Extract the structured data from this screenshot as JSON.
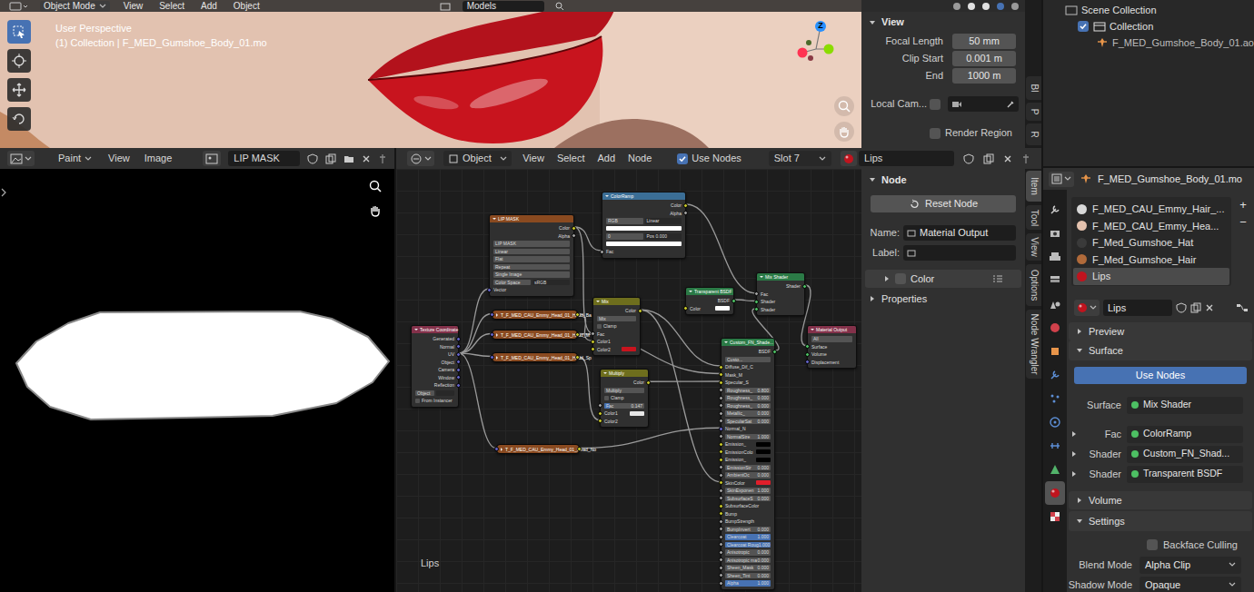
{
  "viewport": {
    "header": {
      "mode": "Object Mode",
      "menus": [
        "View",
        "Select",
        "Add",
        "Object"
      ],
      "collection": "Models"
    },
    "perspective": "User Perspective",
    "collection_line": "(1) Collection | F_MED_Gumshoe_Body_01.mo",
    "gizmo_axis": "Z",
    "tools": [
      {
        "selected": true
      },
      {
        "selected": false
      },
      {
        "selected": false
      },
      {
        "selected": false
      }
    ],
    "view_panel": {
      "title": "View",
      "expanded": true,
      "fields": [
        {
          "label": "Focal Length",
          "value": "50 mm"
        },
        {
          "label": "Clip Start",
          "value": "0.001 m"
        },
        {
          "label": "End",
          "value": "1000 m"
        }
      ],
      "local_camera": {
        "label": "Local Cam...",
        "checked": false
      },
      "render_region": {
        "label": "Render Region",
        "checked": false
      }
    },
    "tabs": [
      {
        "label": "Bl",
        "selected": false
      },
      {
        "label": "P",
        "selected": false
      },
      {
        "label": "R",
        "selected": false
      }
    ]
  },
  "outliner": {
    "items": [
      {
        "label": "Scene Collection",
        "kind": "scene"
      },
      {
        "label": "Collection",
        "kind": "collection",
        "checked": true
      },
      {
        "label": "F_MED_Gumshoe_Body_01.ao",
        "kind": "object"
      }
    ]
  },
  "image_editor": {
    "mode": "Paint",
    "menus": [
      "View",
      "Image"
    ],
    "image": "LIP MASK"
  },
  "node_editor": {
    "object": "Object",
    "menus": [
      "View",
      "Select",
      "Add",
      "Node"
    ],
    "use_nodes": {
      "label": "Use Nodes",
      "checked": true
    },
    "slot": "Slot 7",
    "material": "Lips",
    "label": "Lips",
    "nodes": [
      {
        "title": "Texture Coordinate",
        "kind": "full",
        "color": "#83314a",
        "rows": [
          {
            "kind": "out",
            "label": "Generated",
            "socket": "vector"
          },
          {
            "kind": "out",
            "label": "Normal",
            "socket": "vector"
          },
          {
            "kind": "out",
            "label": "UV",
            "socket": "vector"
          },
          {
            "kind": "out",
            "label": "Object",
            "socket": "vector"
          },
          {
            "kind": "out",
            "label": "Camera",
            "socket": "vector"
          },
          {
            "kind": "out",
            "label": "Window",
            "socket": "vector"
          },
          {
            "kind": "out",
            "label": "Reflection",
            "socket": "vector"
          },
          {
            "kind": "pair",
            "label": "Object",
            "value": ""
          },
          {
            "kind": "check",
            "label": "From Instancer",
            "checked": false
          }
        ]
      },
      {
        "title": "LIP MASK",
        "kind": "full",
        "color": "#8a4a20",
        "rows": [
          {
            "kind": "out",
            "label": "Color",
            "socket": "color"
          },
          {
            "kind": "out",
            "label": "Alpha",
            "socket": "float"
          },
          {
            "kind": "field",
            "label": "LIP MASK"
          },
          {
            "kind": "field",
            "label": "Linear"
          },
          {
            "kind": "field",
            "label": "Flat"
          },
          {
            "kind": "field",
            "label": "Repeat"
          },
          {
            "kind": "field",
            "label": "Single Image"
          },
          {
            "kind": "pair",
            "label": "Color Space",
            "value": "sRGB"
          },
          {
            "kind": "in",
            "label": "Vector",
            "socket": "vector"
          }
        ]
      },
      {
        "title": "ColorRamp",
        "kind": "full",
        "color": "#3b6e96",
        "rows": [
          {
            "kind": "out",
            "label": "Color",
            "socket": "color"
          },
          {
            "kind": "out",
            "label": "Alpha",
            "socket": "float"
          },
          {
            "kind": "pair",
            "label": "RGB",
            "value": "Linear"
          },
          {
            "kind": "bar",
            "color": "#ffffff"
          },
          {
            "kind": "pair",
            "label": "0",
            "value": "Pos 0.000"
          },
          {
            "kind": "bar",
            "color": "#ffffff"
          },
          {
            "kind": "in",
            "label": "Fac",
            "socket": "float"
          }
        ]
      },
      {
        "title": "Mix",
        "kind": "full",
        "color": "#6e6e1d",
        "rows": [
          {
            "kind": "out",
            "label": "Color",
            "socket": "color"
          },
          {
            "kind": "field",
            "label": "Mix"
          },
          {
            "kind": "check",
            "label": "Clamp",
            "checked": false
          },
          {
            "kind": "in",
            "label": "Fac",
            "socket": "float"
          },
          {
            "kind": "in",
            "label": "Color1",
            "socket": "color"
          },
          {
            "kind": "swatch",
            "label": "Color2",
            "color": "#c8141e",
            "socket": "color"
          }
        ]
      },
      {
        "title": "Multiply",
        "kind": "full",
        "color": "#6e6e1d",
        "rows": [
          {
            "kind": "out",
            "label": "Color",
            "socket": "color"
          },
          {
            "kind": "field",
            "label": "Multiply"
          },
          {
            "kind": "check",
            "label": "Clamp",
            "checked": false
          },
          {
            "kind": "slider",
            "label": "Fac",
            "value": "0.147",
            "level": 0.147,
            "socket": "float"
          },
          {
            "kind": "swatch",
            "label": "Color1",
            "color": "#e6e6e6",
            "socket": "color"
          },
          {
            "kind": "in",
            "label": "Color2",
            "socket": "color"
          }
        ]
      },
      {
        "title": "T_F_MED_CAU_Emmy_Head_01_Head_Ba",
        "kind": "collapsed",
        "color": "#8a4a20",
        "rows": []
      },
      {
        "title": "T_F_MED_CAU_Emmy_Head_01_Head_M",
        "kind": "collapsed",
        "color": "#8a4a20",
        "rows": []
      },
      {
        "title": "T_F_MED_CAU_Emmy_Head_01_Head_Sp",
        "kind": "collapsed",
        "color": "#8a4a20",
        "rows": []
      },
      {
        "title": "T_F_MED_CAU_Emmy_Head_01_Head_No",
        "kind": "collapsed",
        "color": "#8a4a20",
        "rows": []
      },
      {
        "title": "Transparent BSDF",
        "kind": "full",
        "color": "#2b7a46",
        "rows": [
          {
            "kind": "out",
            "label": "BSDF",
            "socket": "shader"
          },
          {
            "kind": "swatch",
            "label": "Color",
            "color": "#ffffff",
            "socket": "color"
          }
        ]
      },
      {
        "title": "Mix Shader",
        "kind": "full",
        "color": "#2b7a46",
        "rows": [
          {
            "kind": "out",
            "label": "Shader",
            "socket": "shader"
          },
          {
            "kind": "in",
            "label": "Fac",
            "socket": "float"
          },
          {
            "kind": "in",
            "label": "Shader",
            "socket": "shader"
          },
          {
            "kind": "in",
            "label": "Shader",
            "socket": "shader"
          }
        ]
      },
      {
        "title": "Material Output",
        "kind": "full",
        "color": "#83314a",
        "rows": [
          {
            "kind": "field",
            "label": "All"
          },
          {
            "kind": "in",
            "label": "Surface",
            "socket": "shader"
          },
          {
            "kind": "in",
            "label": "Volume",
            "socket": "shader"
          },
          {
            "kind": "in",
            "label": "Displacement",
            "socket": "vector"
          }
        ]
      },
      {
        "title": "Custom_FN_Shade...",
        "kind": "full",
        "color": "#2b7a46",
        "rows": [
          {
            "kind": "out",
            "label": "BSDF",
            "socket": "shader"
          },
          {
            "kind": "field",
            "label": "Custo..."
          },
          {
            "kind": "in",
            "label": "Diffuse_Dif_C",
            "socket": "color"
          },
          {
            "kind": "in",
            "label": "Mask_M",
            "socket": "color"
          },
          {
            "kind": "in",
            "label": "Specular_S",
            "socket": "color"
          },
          {
            "kind": "value",
            "label": "Roughness_",
            "value": "0.800",
            "socket": "float"
          },
          {
            "kind": "value",
            "label": "Roughness_",
            "value": "0.000",
            "socket": "float"
          },
          {
            "kind": "value",
            "label": "Roughness_",
            "value": "0.000",
            "socket": "float"
          },
          {
            "kind": "value",
            "label": "Metallic_",
            "value": "0.000",
            "socket": "float"
          },
          {
            "kind": "value",
            "label": "SpecularSat",
            "value": "0.000",
            "socket": "float"
          },
          {
            "kind": "in",
            "label": "Normal_N",
            "socket": "vector"
          },
          {
            "kind": "value",
            "label": "NormalStre",
            "value": "1.000",
            "socket": "float"
          },
          {
            "kind": "swatch",
            "label": "Emission_",
            "color": "#000000",
            "socket": "color"
          },
          {
            "kind": "swatch",
            "label": "EmissionColo",
            "color": "#000000",
            "socket": "color"
          },
          {
            "kind": "swatch",
            "label": "Emission_",
            "color": "#000000",
            "socket": "color"
          },
          {
            "kind": "value",
            "label": "EmissionStr",
            "value": "0.000",
            "socket": "float"
          },
          {
            "kind": "value",
            "label": "AmbientOc",
            "value": "0.000",
            "socket": "float"
          },
          {
            "kind": "swatch",
            "label": "SkinColor",
            "color": "#e01e2a",
            "socket": "color"
          },
          {
            "kind": "value",
            "label": "SkinExponen",
            "value": "1.000",
            "socket": "float"
          },
          {
            "kind": "value",
            "label": "SubsurfaceS",
            "value": "0.000",
            "socket": "float"
          },
          {
            "kind": "in",
            "label": "SubsurfaceColor",
            "socket": "color"
          },
          {
            "kind": "in",
            "label": "Bump",
            "socket": "color"
          },
          {
            "kind": "in",
            "label": "BumpStrength",
            "socket": "float"
          },
          {
            "kind": "value",
            "label": "BumpInvert",
            "value": "0.000",
            "socket": "float"
          },
          {
            "kind": "slider",
            "label": "Clearcoat",
            "value": "1.000",
            "level": 1,
            "socket": "float"
          },
          {
            "kind": "slider",
            "label": "Clearcoat Roug",
            "value": "1.000",
            "level": 1,
            "socket": "float"
          },
          {
            "kind": "value",
            "label": "Anisotropic",
            "value": "0.000",
            "socket": "float"
          },
          {
            "kind": "value",
            "label": "Anisotropic ma",
            "value": "0.000",
            "socket": "float"
          },
          {
            "kind": "value",
            "label": "Sheen_Mask",
            "value": "0.000",
            "socket": "float"
          },
          {
            "kind": "value",
            "label": "Sheen_Tint",
            "value": "0.000",
            "socket": "float"
          },
          {
            "kind": "slider",
            "label": "Alpha",
            "value": "1.000",
            "level": 1,
            "socket": "float"
          }
        ]
      }
    ]
  },
  "node_sidebar": {
    "panel": "Node",
    "expanded": true,
    "reset": "Reset Node",
    "name": {
      "label": "Name:",
      "value": "Material Output"
    },
    "label": {
      "label": "Label:",
      "value": ""
    },
    "color": {
      "label": "Color",
      "checked": false,
      "expanded": false
    },
    "properties": {
      "label": "Properties",
      "expanded": false
    },
    "tabs": [
      {
        "label": "Item",
        "selected": true
      },
      {
        "label": "Tool",
        "selected": false
      },
      {
        "label": "View",
        "selected": false
      },
      {
        "label": "Options",
        "selected": false
      },
      {
        "label": "Node Wrangler",
        "selected": false
      }
    ]
  },
  "properties": {
    "object": "F_MED_Gumshoe_Body_01.mo",
    "tabs": [
      {
        "selected": false
      },
      {
        "selected": false
      },
      {
        "selected": false
      },
      {
        "selected": false
      },
      {
        "selected": false
      },
      {
        "selected": false
      },
      {
        "selected": false
      },
      {
        "selected": false
      },
      {
        "selected": false
      },
      {
        "selected": false
      },
      {
        "selected": false
      },
      {
        "selected": false
      },
      {
        "selected": true
      },
      {
        "selected": false
      }
    ],
    "slots": [
      {
        "label": "F_MED_CAU_Emmy_Hair_...",
        "color": "#d8d8d8",
        "selected": false
      },
      {
        "label": "F_MED_CAU_Emmy_Hea...",
        "color": "#e4c2ae",
        "selected": false
      },
      {
        "label": "F_Med_Gumshoe_Hat",
        "color": "#3a3a3a",
        "selected": false
      },
      {
        "label": "F_Med_Gumshoe_Hair",
        "color": "#b06a3a",
        "selected": false
      },
      {
        "label": "Lips",
        "color": "#c0141e",
        "selected": true
      }
    ],
    "slot_buttons": [
      "+",
      "−"
    ],
    "material": "Lips",
    "preview": {
      "label": "Preview",
      "expanded": false
    },
    "surface": {
      "label": "Surface",
      "expanded": true,
      "use_nodes": "Use Nodes",
      "rows": [
        {
          "label": "Surface",
          "value": "Mix Shader",
          "kind": "plain"
        },
        {
          "label": "Fac",
          "value": "ColorRamp",
          "kind": "expandable",
          "expanded": false
        },
        {
          "label": "Shader",
          "value": "Custom_FN_Shad...",
          "kind": "expandable",
          "expanded": false
        },
        {
          "label": "Shader",
          "value": "Transparent BSDF",
          "kind": "expandable",
          "expanded": false
        }
      ]
    },
    "volume": {
      "label": "Volume",
      "expanded": false
    },
    "settings": {
      "label": "Settings",
      "expanded": true,
      "backface_culling": {
        "label": "Backface Culling",
        "checked": false
      },
      "rows": [
        {
          "label": "Blend Mode",
          "value": "Alpha Clip"
        },
        {
          "label": "Shadow Mode",
          "value": "Opaque"
        }
      ]
    }
  }
}
